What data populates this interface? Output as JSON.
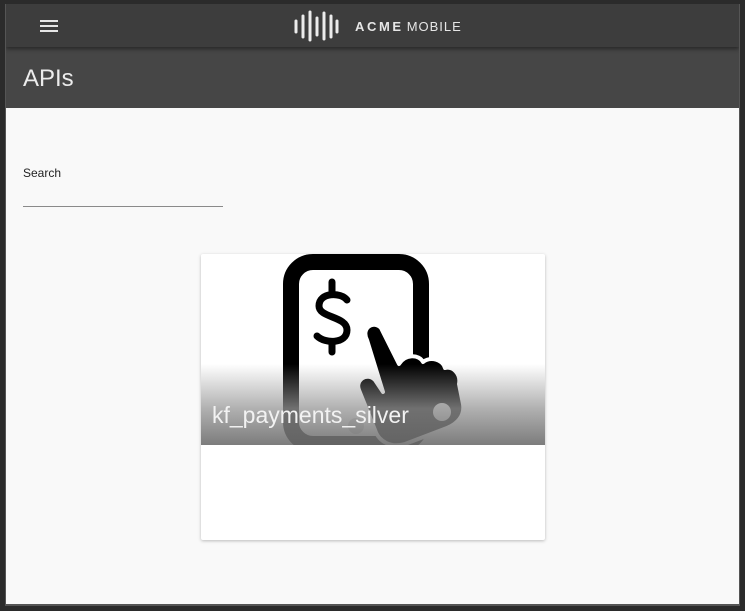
{
  "header": {
    "menu_icon": "hamburger-menu-icon",
    "logo_icon": "sound-wave-logo-icon",
    "brand_bold": "ACME",
    "brand_light": "MOBILE"
  },
  "page": {
    "title": "APIs"
  },
  "search": {
    "label": "Search",
    "value": "",
    "placeholder": ""
  },
  "cards": [
    {
      "title": "kf_payments_silver",
      "icon": "mobile-payment-tap-icon"
    }
  ],
  "colors": {
    "toolbar": "#3d3d3d",
    "titlebar": "#464646",
    "background": "#f9f9f9",
    "card": "#ffffff"
  }
}
